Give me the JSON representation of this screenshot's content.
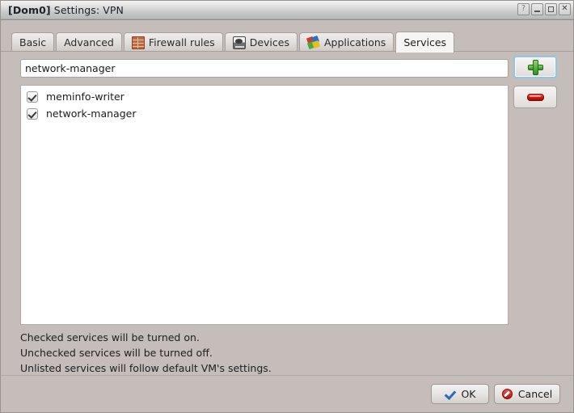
{
  "window": {
    "vm_tag": "[Dom0]",
    "title": "Settings: VPN",
    "controls": {
      "help": "?",
      "minimize": "Minimize",
      "maximize": "Maximize",
      "close": "Close"
    }
  },
  "tabs": [
    {
      "label": "Basic",
      "icon": null,
      "active": false
    },
    {
      "label": "Advanced",
      "icon": null,
      "active": false
    },
    {
      "label": "Firewall rules",
      "icon": "firewall-brick-icon",
      "active": false
    },
    {
      "label": "Devices",
      "icon": "device-disk-icon",
      "active": false
    },
    {
      "label": "Applications",
      "icon": "applications-icon",
      "active": false
    },
    {
      "label": "Services",
      "icon": null,
      "active": true
    }
  ],
  "services_tab": {
    "search": {
      "value": "network-manager",
      "placeholder": ""
    },
    "add_button": {
      "icon": "plus-icon",
      "label": ""
    },
    "remove_button": {
      "icon": "minus-icon",
      "label": ""
    },
    "list": [
      {
        "name": "meminfo-writer",
        "checked": true
      },
      {
        "name": "network-manager",
        "checked": true
      }
    ],
    "help_lines": [
      "Checked services will be turned on.",
      "Unchecked services will be turned off.",
      "Unlisted services will follow default VM's settings."
    ]
  },
  "footer": {
    "ok_label": "OK",
    "cancel_label": "Cancel"
  },
  "colors": {
    "window_background": "#c4bdba",
    "list_background": "#ffffff",
    "accent_add": "#2f8e20",
    "accent_remove": "#d51d12",
    "ok_check": "#2a6db5",
    "cancel_deny": "#b3150b",
    "focus_ring": "#8ec6ea"
  }
}
